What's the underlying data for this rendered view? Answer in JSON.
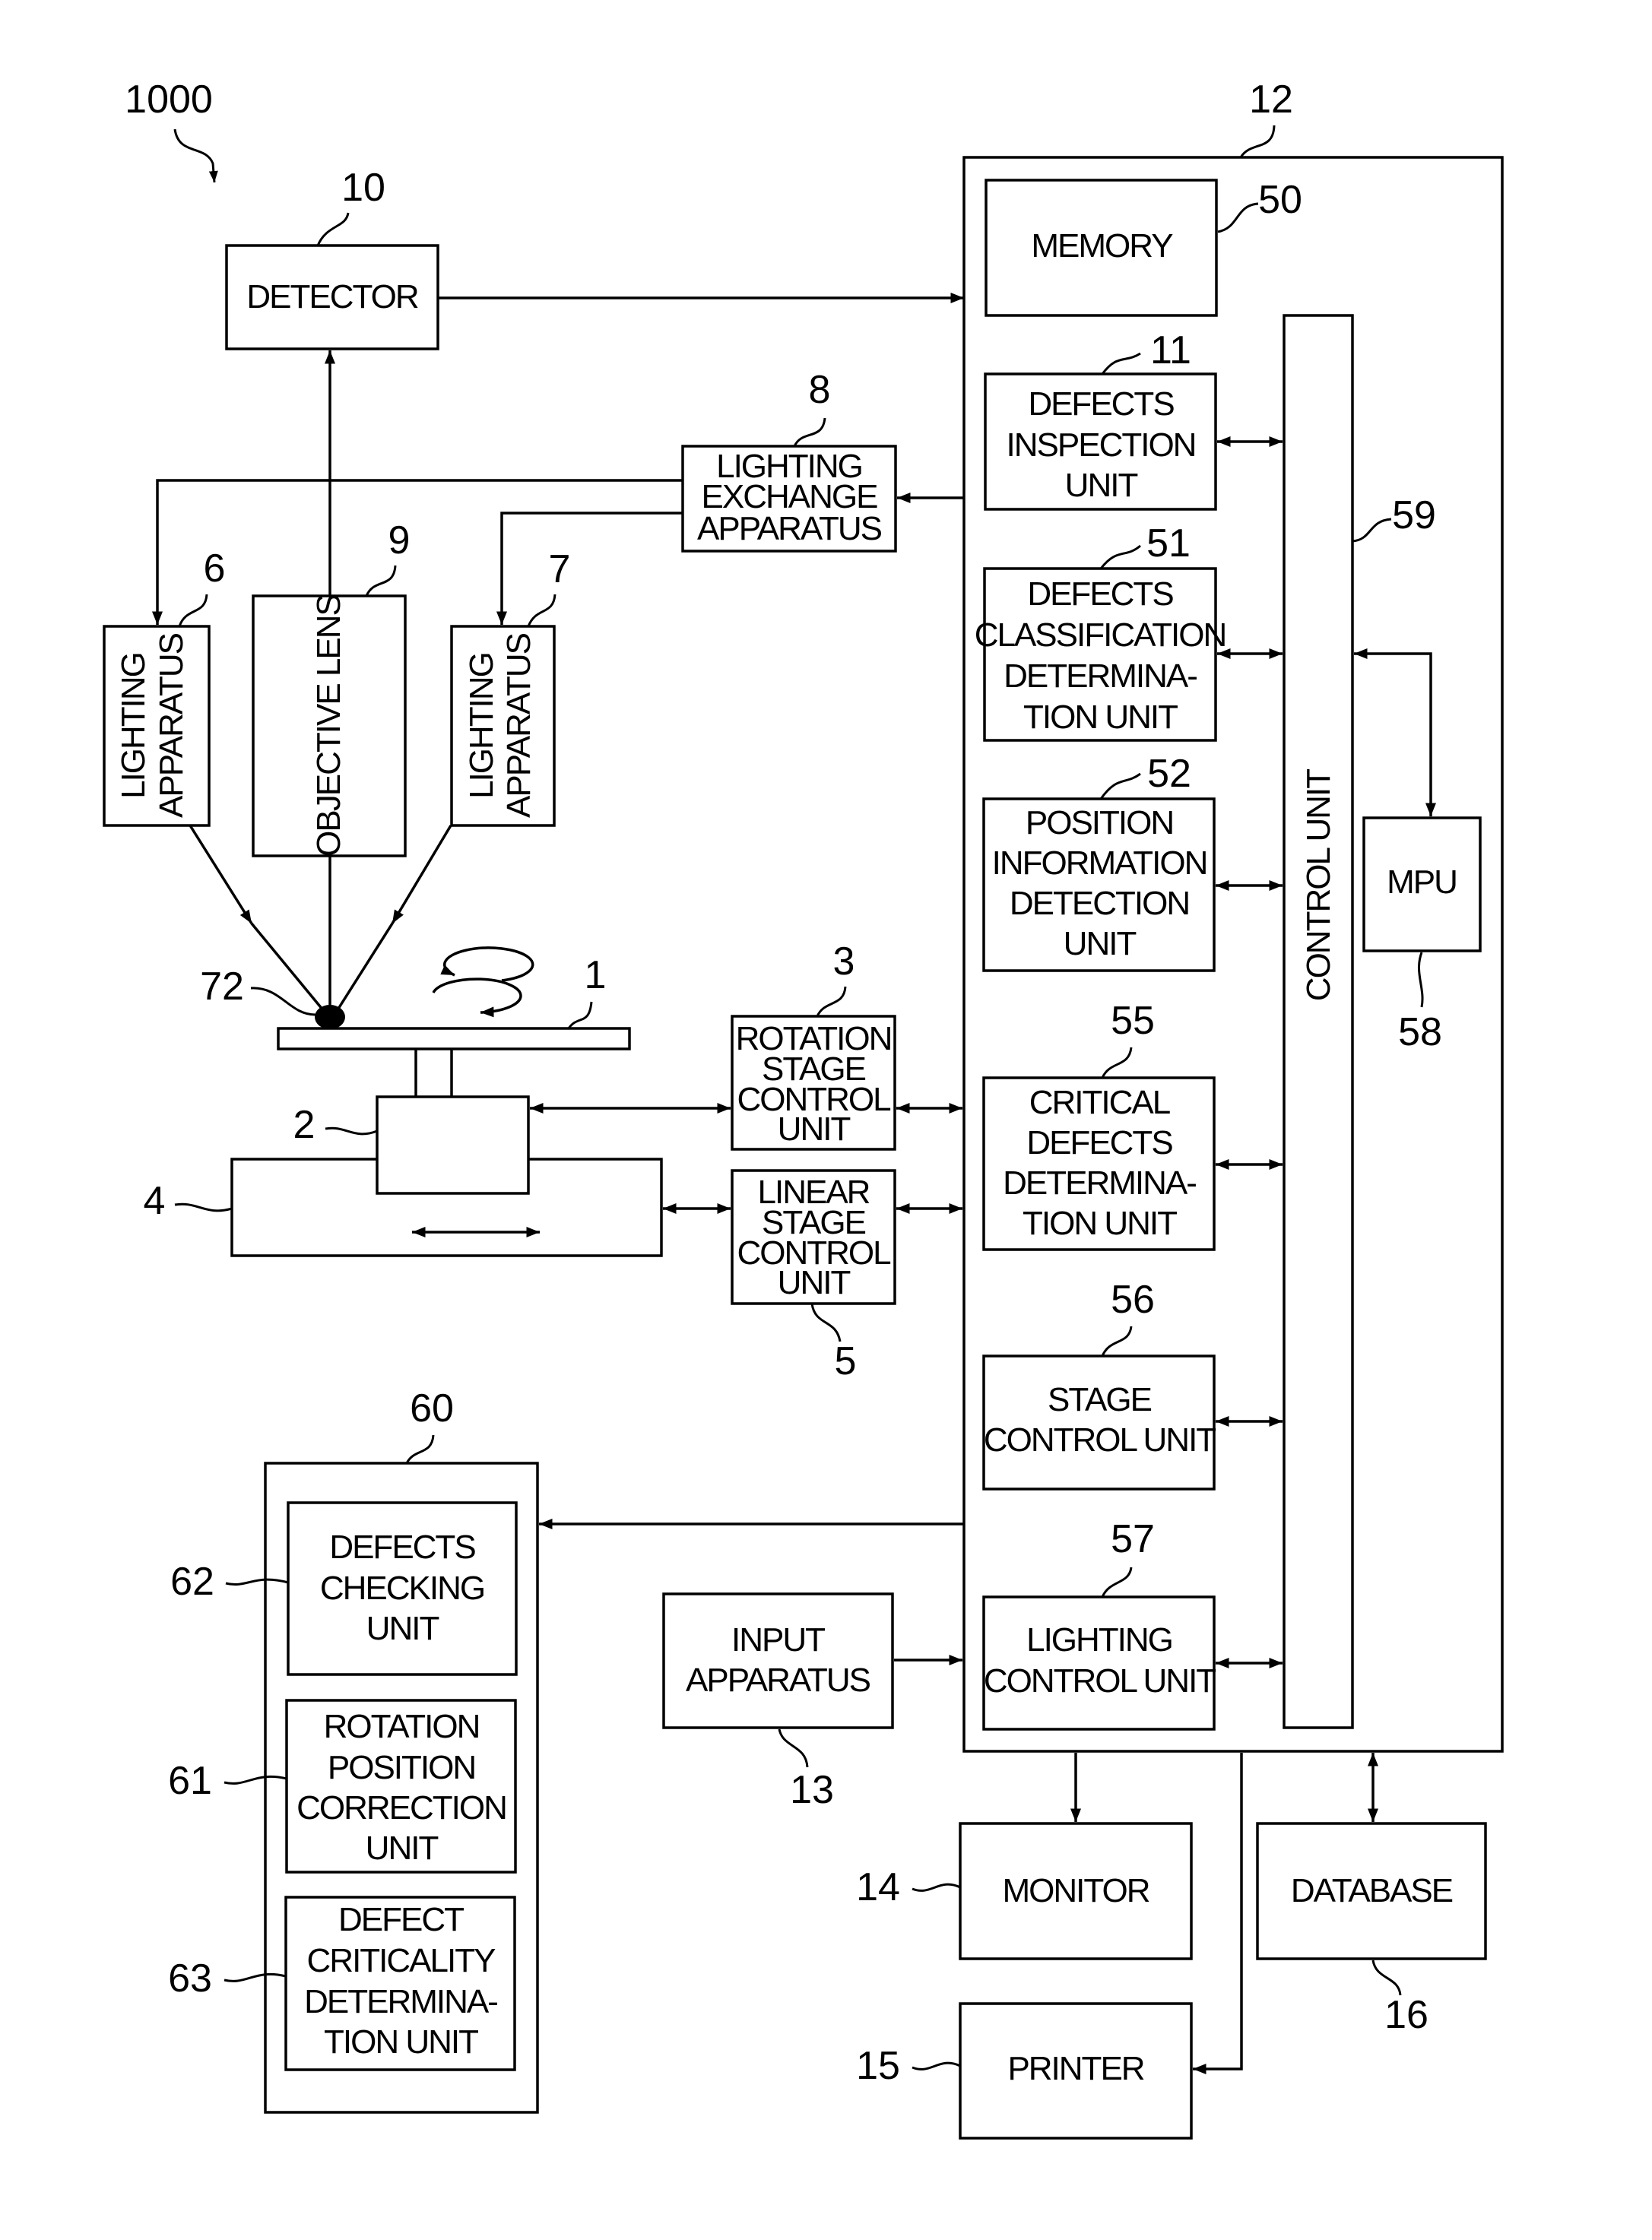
{
  "figure": {
    "ref": "1000",
    "blocks": {
      "detector": {
        "ref": "10",
        "lines": [
          "DETECTOR"
        ]
      },
      "lighting_exchange": {
        "ref": "8",
        "lines": [
          "LIGHTING",
          "EXCHANGE",
          "APPARATUS"
        ]
      },
      "lighting_left": {
        "ref": "6",
        "lines": [
          "LIGHTING",
          "APPARATUS"
        ]
      },
      "objective_lens": {
        "ref": "9",
        "lines": [
          "OBJECTIVE LENS"
        ]
      },
      "lighting_right": {
        "ref": "7",
        "lines": [
          "LIGHTING",
          "APPARATUS"
        ]
      },
      "wafer_ref": "1",
      "defect_ref": "72",
      "rotation_stage_ref": "2",
      "linear_stage_ref": "4",
      "rotation_stage_control": {
        "ref": "3",
        "lines": [
          "ROTATION",
          "STAGE",
          "CONTROL",
          "UNIT"
        ]
      },
      "linear_stage_control": {
        "ref": "5",
        "lines": [
          "LINEAR",
          "STAGE",
          "CONTROL",
          "UNIT"
        ]
      },
      "computer": {
        "ref": "12"
      },
      "memory": {
        "ref": "50",
        "lines": [
          "MEMORY"
        ]
      },
      "defects_inspection": {
        "ref": "11",
        "lines": [
          "DEFECTS",
          "INSPECTION",
          "UNIT"
        ]
      },
      "defects_classification": {
        "ref": "51",
        "lines": [
          "DEFECTS",
          "CLASSIFICATION",
          "DETERMINA-",
          "TION UNIT"
        ]
      },
      "position_information": {
        "ref": "52",
        "lines": [
          "POSITION",
          "INFORMATION",
          "DETECTION",
          "UNIT"
        ]
      },
      "critical_defects": {
        "ref": "55",
        "lines": [
          "CRITICAL",
          "DEFECTS",
          "DETERMINA-",
          "TION UNIT"
        ]
      },
      "stage_control": {
        "ref": "56",
        "lines": [
          "STAGE",
          "CONTROL UNIT"
        ]
      },
      "lighting_control": {
        "ref": "57",
        "lines": [
          "LIGHTING",
          "CONTROL UNIT"
        ]
      },
      "control_unit": {
        "ref": "59",
        "lines": [
          "CONTROL UNIT"
        ]
      },
      "mpu": {
        "ref": "58",
        "lines": [
          "MPU"
        ]
      },
      "group_60": {
        "ref": "60"
      },
      "defects_checking": {
        "ref": "62",
        "lines": [
          "DEFECTS",
          "CHECKING",
          "UNIT"
        ]
      },
      "rotation_position_correction": {
        "ref": "61",
        "lines": [
          "ROTATION",
          "POSITION",
          "CORRECTION",
          "UNIT"
        ]
      },
      "defect_criticality": {
        "ref": "63",
        "lines": [
          "DEFECT",
          "CRITICALITY",
          "DETERMINA-",
          "TION UNIT"
        ]
      },
      "input_apparatus": {
        "ref": "13",
        "lines": [
          "INPUT",
          "APPARATUS"
        ]
      },
      "monitor": {
        "ref": "14",
        "lines": [
          "MONITOR"
        ]
      },
      "printer": {
        "ref": "15",
        "lines": [
          "PRINTER"
        ]
      },
      "database": {
        "ref": "16",
        "lines": [
          "DATABASE"
        ]
      }
    }
  }
}
